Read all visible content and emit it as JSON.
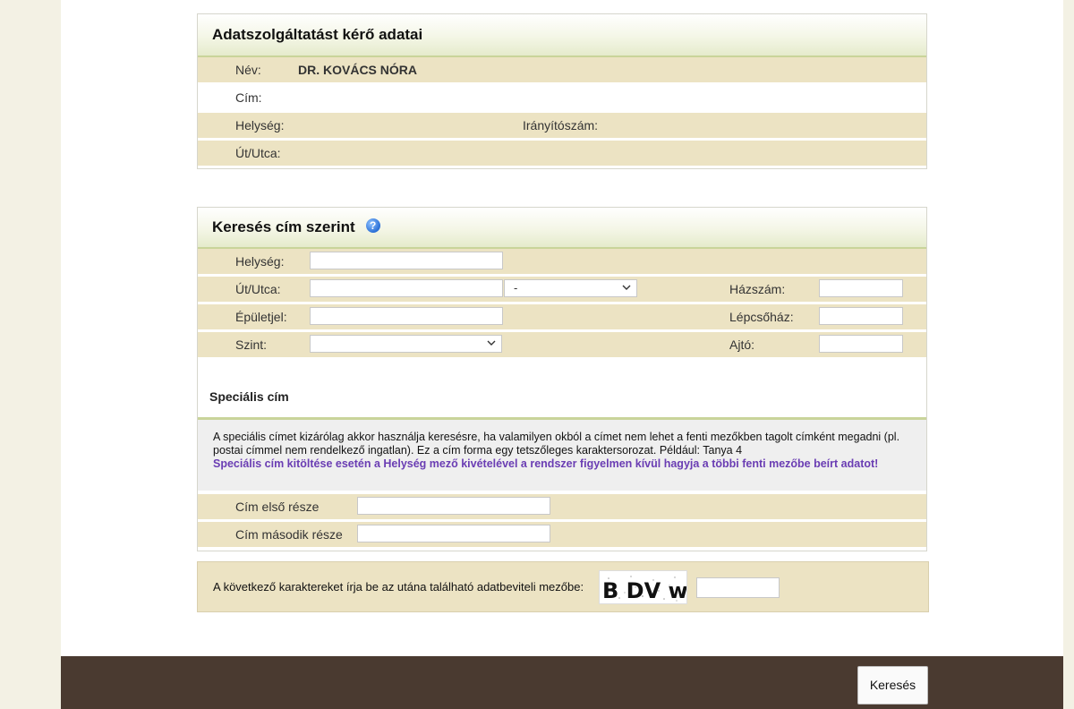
{
  "requester": {
    "title": "Adatszolgáltatást kérő adatai",
    "name_label": "Név:",
    "name_value": "DR. KOVÁCS NÓRA",
    "address_label": "Cím:",
    "city_label": "Helység:",
    "zip_label": "Irányítószám:",
    "street_label": "Út/Utca:"
  },
  "search": {
    "title": "Keresés cím szerint",
    "help_icon": "question-help-icon",
    "city_label": "Helység:",
    "city_value": "",
    "street_label": "Út/Utca:",
    "street_value": "",
    "street_type_selected": "-",
    "house_no_label": "Házszám:",
    "building_label": "Épületjel:",
    "staircase_label": "Lépcsőház:",
    "floor_label": "Szint:",
    "floor_selected": "",
    "door_label": "Ajtó:"
  },
  "special": {
    "title": "Speciális cím",
    "info_text": "A speciális címet kizárólag akkor használja keresésre, ha valamilyen okból a címet nem lehet a fenti mezőkben tagolt címként megadni (pl. postai címmel nem rendelkező ingatlan). Ez a cím forma egy tetszőleges karaktersorozat. Például: Tanya 4",
    "warning_text": "Speciális cím kitöltése esetén a Helység mező kivételével a rendszer figyelmen kívül hagyja a többi fenti mezőbe beírt adatot!",
    "first_part_label": "Cím első része",
    "second_part_label": "Cím második része"
  },
  "captcha": {
    "label": "A következő karaktereket írja be az utána található adatbeviteli mezőbe:",
    "image_text": "B DV w"
  },
  "actions": {
    "search_button": "Keresés"
  },
  "colors": {
    "row_tan": "#ece3c3",
    "header_accent": "#c9d49a",
    "warning": "#6a3db3",
    "footer": "#4a3a30"
  }
}
